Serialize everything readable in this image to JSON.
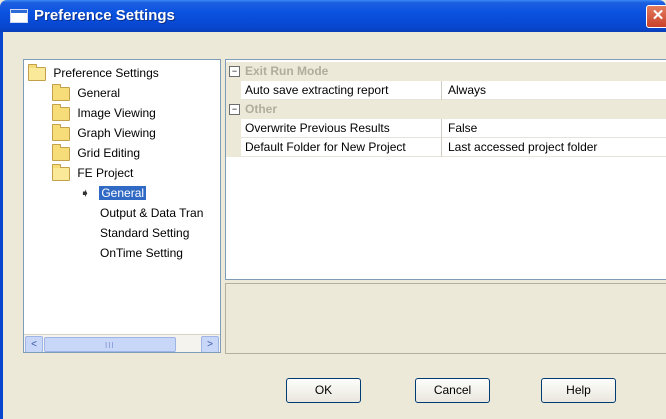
{
  "window": {
    "title": "Preference Settings",
    "close_glyph": "✕"
  },
  "tree": {
    "items": [
      {
        "label": "Preference Settings",
        "icon": "folder-open-icon"
      },
      {
        "label": "General",
        "icon": "folder-icon"
      },
      {
        "label": "Image Viewing",
        "icon": "folder-icon"
      },
      {
        "label": "Graph Viewing",
        "icon": "folder-icon"
      },
      {
        "label": "Grid Editing",
        "icon": "folder-icon"
      },
      {
        "label": "FE Project",
        "icon": "folder-open-icon"
      },
      {
        "label": "General",
        "icon": "arrow-right-icon",
        "selected": true
      },
      {
        "label": "Output & Data Tran",
        "icon": "none"
      },
      {
        "label": "Standard Setting",
        "icon": "none"
      },
      {
        "label": "OnTime Setting",
        "icon": "none"
      }
    ],
    "arrow_glyph": "➧",
    "scroll_left": "<",
    "scroll_right": ">",
    "scroll_grip": "III"
  },
  "grid": {
    "categories": [
      {
        "label": "Exit Run Mode",
        "toggle": "−",
        "props": [
          {
            "name": "Auto save extracting report",
            "value": "Always"
          }
        ]
      },
      {
        "label": "Other",
        "toggle": "−",
        "props": [
          {
            "name": "Overwrite Previous Results",
            "value": "False"
          },
          {
            "name": "Default Folder for New Project",
            "value": "Last accessed project folder"
          }
        ]
      }
    ]
  },
  "buttons": {
    "ok": "OK",
    "cancel": "Cancel",
    "help": "Help"
  },
  "colors": {
    "titlebar": "#0a52e0",
    "selection": "#316AC5",
    "dialog_bg": "#ECE9D8"
  }
}
